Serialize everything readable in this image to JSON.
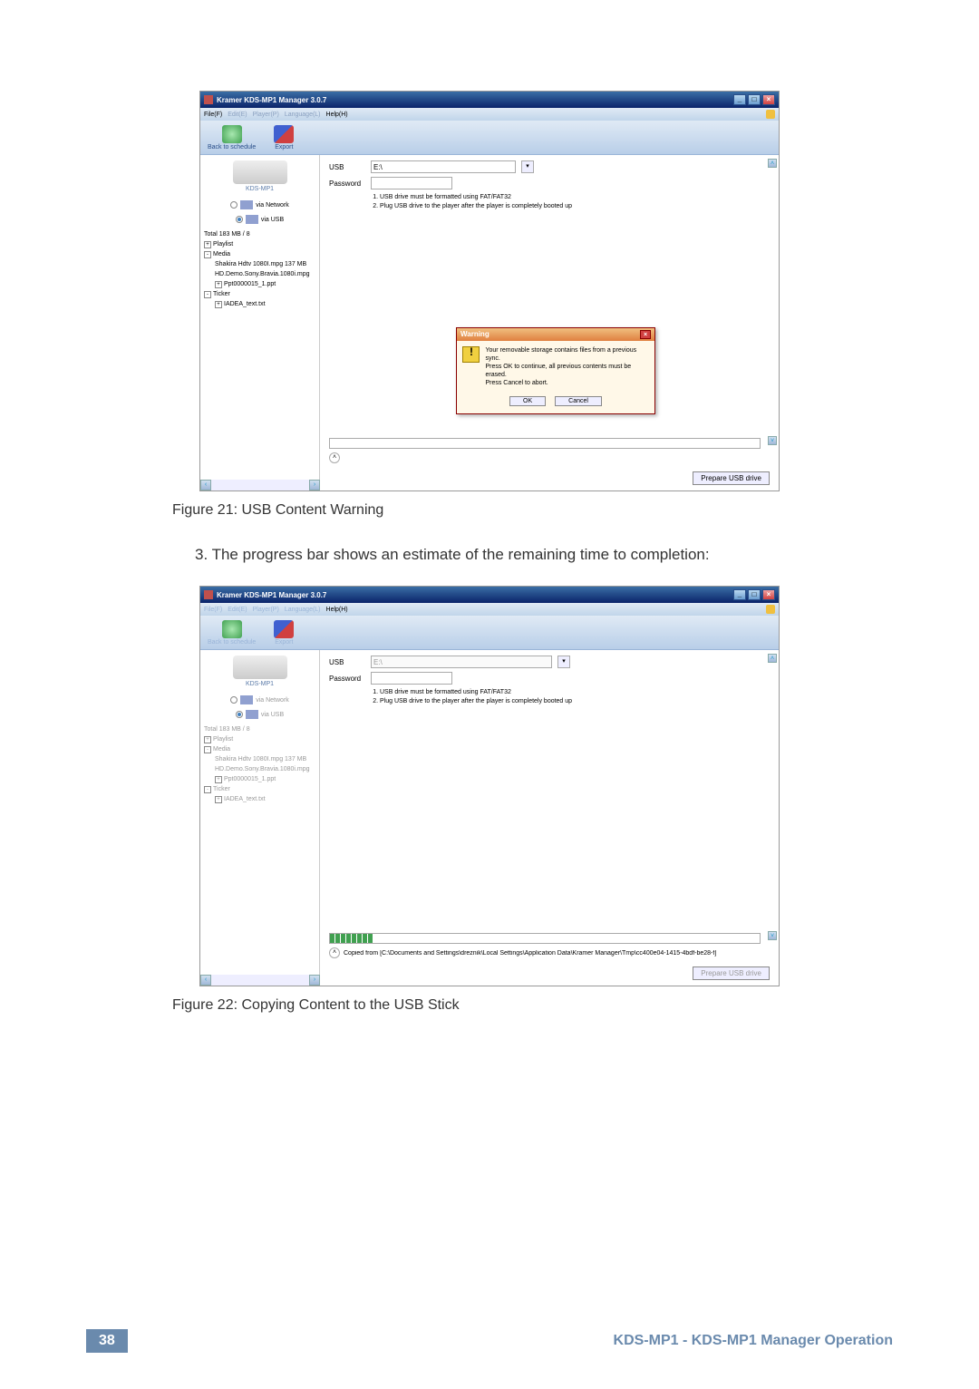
{
  "page": {
    "number": "38",
    "footer_text": "KDS-MP1 - KDS-MP1 Manager Operation",
    "step3": "3.   The progress bar shows an estimate of the remaining time to completion:",
    "fig21_caption": "Figure 21: USB Content Warning",
    "fig22_caption": "Figure 22: Copying Content to the USB Stick"
  },
  "app": {
    "title": "Kramer KDS-MP1 Manager 3.0.7",
    "menu": {
      "file": "File(F)",
      "edit": "Edit(E)",
      "player": "Player(P)",
      "language": "Language(L)",
      "help": "Help(H)"
    },
    "toolbar": {
      "back": "Back to schedule",
      "export": "Export"
    },
    "left": {
      "device": "KDS-MP1",
      "via_network": "via Network",
      "via_usb": "via USB",
      "total": "Total 183 MB / 8",
      "tree": {
        "playlist": "Playlist",
        "media": "Media",
        "media_c1": "Shakira Hdtv 1080I.mpg 137 MB",
        "media_c2": "HD.Demo.Sony.Bravia.1080i.mpg",
        "media_c3": "Ppt0000015_1.ppt",
        "ticker": "Ticker",
        "ticker_c1": "IADEA_text.txt"
      }
    },
    "right": {
      "usb_label": "USB",
      "usb_value": "E:\\",
      "pwd_label": "Password",
      "pwd_value": "",
      "note1": "USB drive must be formatted using FAT/FAT32",
      "note2": "Plug USB drive to the player after the player is completely booted up",
      "prepare_btn": "Prepare USB drive"
    },
    "warning": {
      "title": "Warning",
      "line1": "Your removable storage contains files from a previous sync.",
      "line2": "Press OK to continue, all previous contents must be erased.",
      "line3": "Press Cancel to abort.",
      "ok": "OK",
      "cancel": "Cancel"
    },
    "copying": {
      "status": "Copied from [C:\\Documents and Settings\\dreznik\\Local Settings\\Application Data\\Kramer Manager\\Tmp\\cc400e04-1415-4bdf-be28-f]"
    }
  }
}
